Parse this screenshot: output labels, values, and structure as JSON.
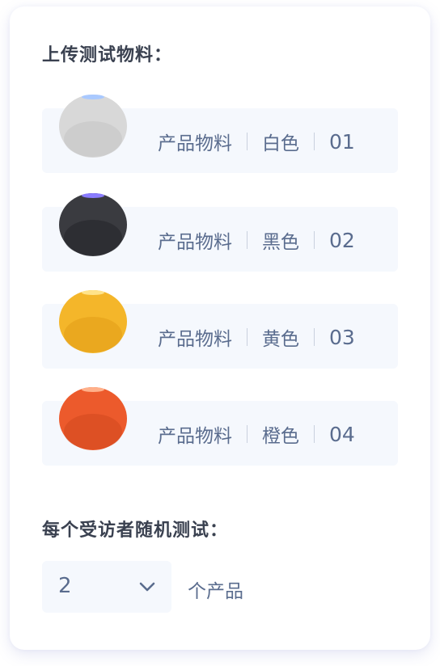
{
  "upload_section": {
    "title": "上传测试物料："
  },
  "products": [
    {
      "label": "产品物料",
      "color": "白色",
      "number": "01",
      "body_color": "#d8d8d8",
      "shade_color": "#b9b9b9",
      "top_color": "#a9c9ff"
    },
    {
      "label": "产品物料",
      "color": "黑色",
      "number": "02",
      "body_color": "#3a3b40",
      "shade_color": "#1e1f23",
      "top_color": "#8a7cff"
    },
    {
      "label": "产品物料",
      "color": "黄色",
      "number": "03",
      "body_color": "#f4b62a",
      "shade_color": "#dd9410",
      "top_color": "#ffe38a"
    },
    {
      "label": "产品物料",
      "color": "橙色",
      "number": "04",
      "body_color": "#ec5a2c",
      "shade_color": "#c8401a",
      "top_color": "#ffb08a"
    }
  ],
  "random_section": {
    "title": "每个受访者随机测试：",
    "selected_value": "2",
    "unit_label": "个产品"
  }
}
